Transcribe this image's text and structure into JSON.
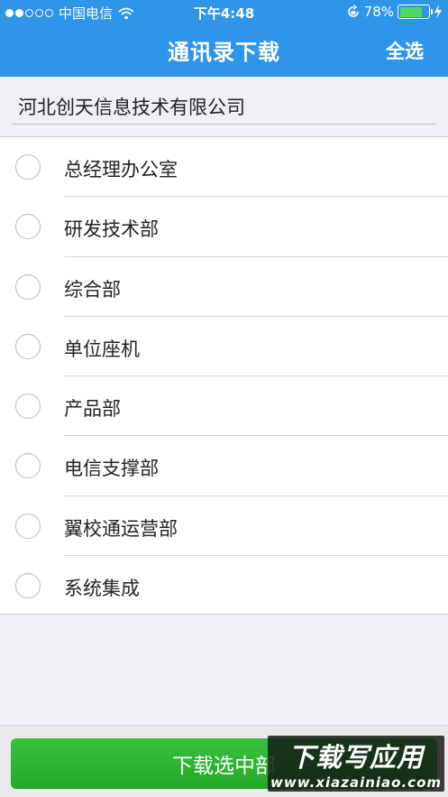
{
  "status_bar": {
    "carrier": "中国电信",
    "time": "下午4:48",
    "battery_percent": "78%",
    "battery_level": 0.78,
    "signal_filled": 2,
    "signal_total": 5
  },
  "nav": {
    "title": "通讯录下载",
    "select_all": "全选"
  },
  "company": {
    "name": "河北创天信息技术有限公司"
  },
  "departments": [
    {
      "label": "总经理办公室",
      "checked": false
    },
    {
      "label": "研发技术部",
      "checked": false
    },
    {
      "label": "综合部",
      "checked": false
    },
    {
      "label": "单位座机",
      "checked": false
    },
    {
      "label": "产品部",
      "checked": false
    },
    {
      "label": "电信支撑部",
      "checked": false
    },
    {
      "label": "翼校通运营部",
      "checked": false
    },
    {
      "label": "系统集成",
      "checked": false
    }
  ],
  "footer": {
    "download_label": "下载选中部"
  },
  "watermark": {
    "line1": "下载写应用",
    "line2": "www.xiazainiao.com"
  },
  "colors": {
    "header": "#2e95e8",
    "button": "#22a826"
  }
}
